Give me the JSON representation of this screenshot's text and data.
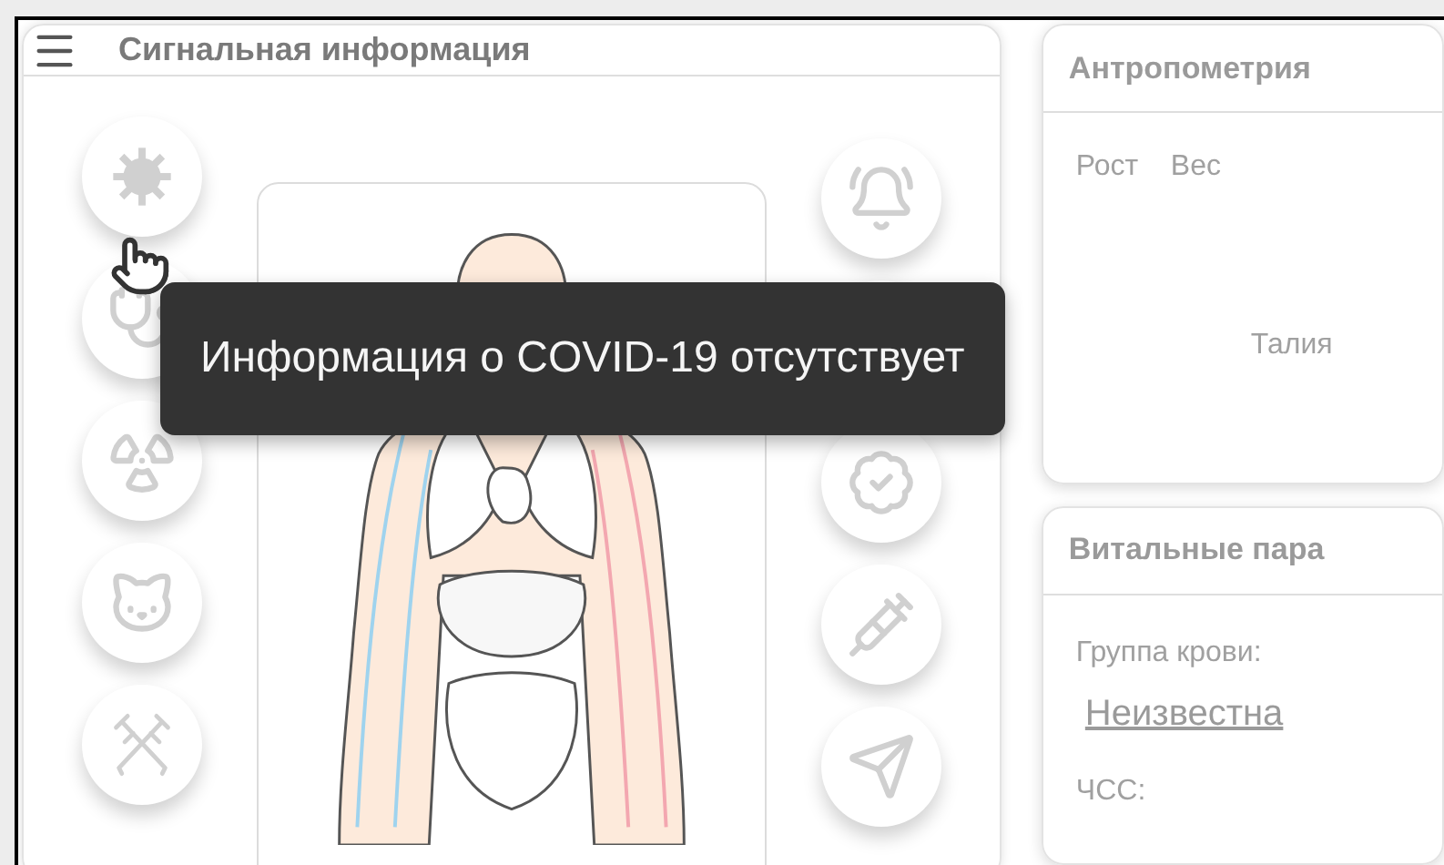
{
  "signal_panel": {
    "title": "Сигнальная информация"
  },
  "tooltip": {
    "text": "Информация о COVID-19 отсутствует"
  },
  "anthropometry": {
    "title": "Антропометрия",
    "fields": [
      {
        "label": "Рост"
      },
      {
        "label": "Вес"
      },
      {
        "label": "Талия"
      }
    ]
  },
  "vitals": {
    "title": "Витальные пара",
    "blood_group_label": "Группа крови:",
    "blood_group_value": "Неизвестна",
    "heart_rate_label": "ЧСС:"
  }
}
